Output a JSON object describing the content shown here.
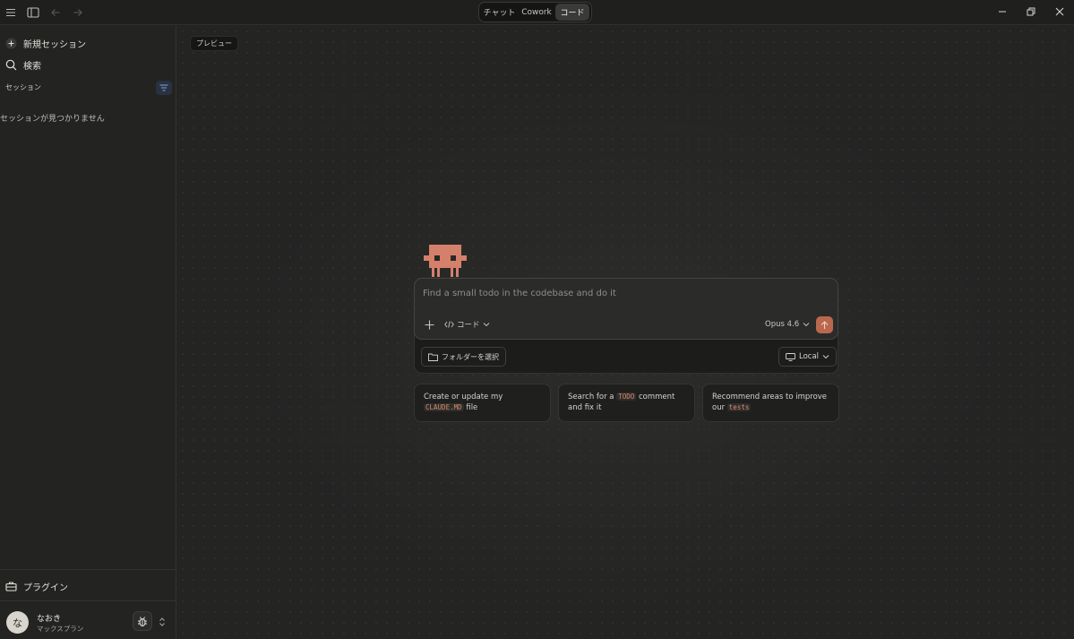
{
  "titlebar": {
    "modes": [
      {
        "label": "チャット",
        "active": false
      },
      {
        "label": "Cowork",
        "active": false
      },
      {
        "label": "コード",
        "active": true
      }
    ]
  },
  "sidebar": {
    "new_session": "新規セッション",
    "search": "検索",
    "section_title": "セッション",
    "empty_message": "セッションが見つかりません",
    "plugins": "プラグイン",
    "user": {
      "avatar_initial": "な",
      "name": "なおき",
      "plan": "マックスプラン"
    }
  },
  "main": {
    "preview_badge": "プレビュー",
    "composer": {
      "placeholder": "Find a small todo in the codebase and do it",
      "mode_label": "コード",
      "model_label": "Opus 4.6",
      "folder_button": "フォルダーを選択",
      "environment_button": "Local"
    },
    "suggestions": [
      {
        "before": "Create or update my ",
        "code": "CLAUDE.MD",
        "after": " file"
      },
      {
        "before": "Search for a ",
        "code": "TODO",
        "after": " comment and fix it"
      },
      {
        "before": "Recommend areas to improve our ",
        "code": "tests",
        "after": ""
      }
    ]
  },
  "colors": {
    "accent": "#b9684e",
    "mascot": "#d4806a",
    "background": "#242423",
    "sidebar": "#232322"
  }
}
